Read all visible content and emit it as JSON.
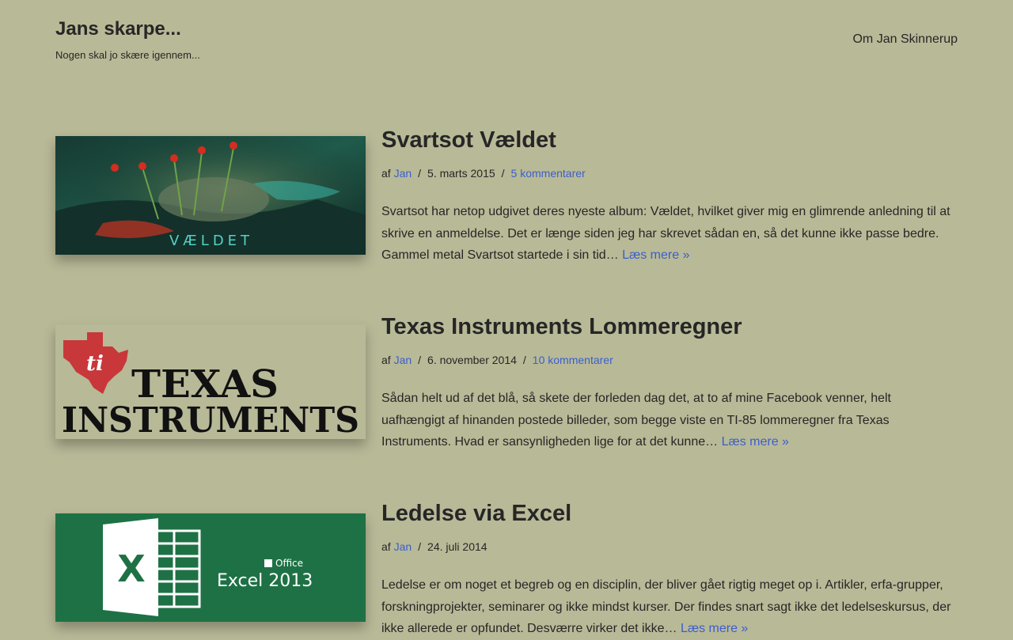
{
  "header": {
    "site_title": "Jans skarpe...",
    "tagline": "Nogen skal jo skære igennem...",
    "nav_item": "Om Jan Skinnerup"
  },
  "posts": [
    {
      "title": "Svartsot Vældet",
      "meta_prefix": "af",
      "author": "Jan",
      "date": "5. marts 2015",
      "comments": "5 kommentarer",
      "excerpt": "Svartsot har netop udgivet deres nyeste album: Vældet, hvilket giver mig en glimrende anledning til at skrive en anmeldelse. Det er længe siden jeg har skrevet sådan en, så det kunne ikke passe bedre. Gammel metal Svartsot startede i sin tid…",
      "read_more": "Læs mere »",
      "thumb_text": "VÆLDET"
    },
    {
      "title": "Texas Instruments Lommeregner",
      "meta_prefix": "af",
      "author": "Jan",
      "date": "6. november 2014",
      "comments": "10 kommentarer",
      "excerpt": "Sådan helt ud af det blå, så skete der forleden dag det, at to af mine Facebook venner, helt uafhængigt af hinanden postede billeder, som begge viste en TI-85 lommeregner fra Texas Instruments. Hvad er sansynligheden lige for at det kunne…",
      "read_more": "Læs mere »",
      "thumb_text_1": "TEXAS",
      "thumb_text_2": "INSTRUMENTS",
      "thumb_logo": "ti"
    },
    {
      "title": "Ledelse via Excel",
      "meta_prefix": "af",
      "author": "Jan",
      "date": "24. juli 2014",
      "excerpt": "Ledelse er om noget et begreb og en disciplin, der bliver gået rigtig meget op i. Artikler, erfa-grupper, forskningprojekter, seminarer og ikke mindst kurser. Der findes snart sagt ikke det ledelseskursus, der ikke allerede er opfundet. Desværre virker det ikke…",
      "read_more": "Læs mere »",
      "thumb_x": "X",
      "thumb_office": "Office",
      "thumb_product": "Excel 2013"
    }
  ],
  "colors": {
    "background": "#b8b997",
    "text": "#272626",
    "link": "#3a5fcd",
    "excel_green": "#1e7145",
    "ti_red": "#c8373a"
  }
}
